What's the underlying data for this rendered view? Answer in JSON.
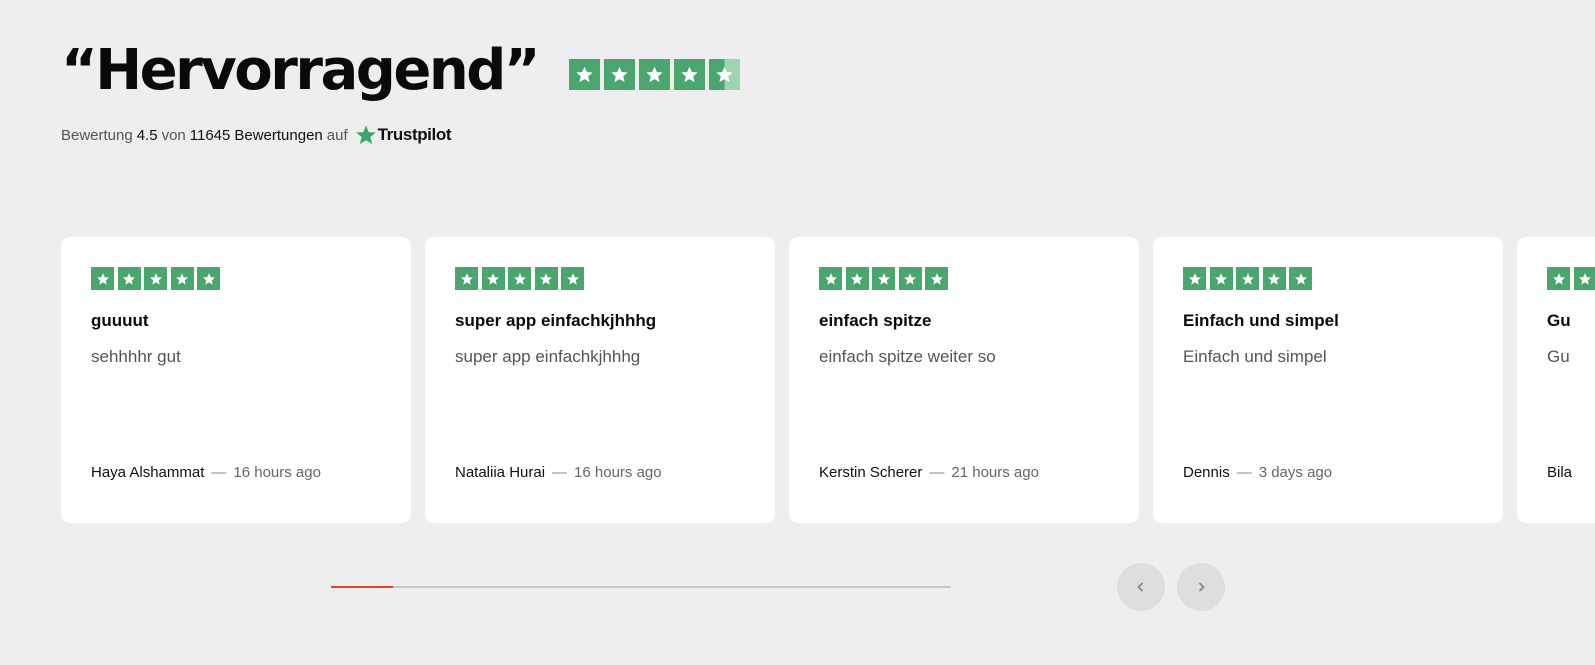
{
  "header": {
    "title": "“Hervorragend”",
    "overall_stars": 4.5,
    "rating_prefix": "Bewertung",
    "rating_value": "4.5",
    "rating_of": "von",
    "review_count": "11645",
    "reviews_word": "Bewertungen",
    "on_word": "auf",
    "platform": "Trustpilot"
  },
  "reviews": [
    {
      "stars": 5,
      "title": "guuuut",
      "text": "sehhhhr gut",
      "author": "Haya Alshammat",
      "time": "16 hours ago"
    },
    {
      "stars": 5,
      "title": "super app einfachkjhhhg",
      "text": "super app einfachkjhhhg",
      "author": "Nataliia Hurai",
      "time": "16 hours ago"
    },
    {
      "stars": 5,
      "title": "einfach spitze",
      "text": "einfach spitze weiter so",
      "author": "Kerstin Scherer",
      "time": "21 hours ago"
    },
    {
      "stars": 5,
      "title": "Einfach und simpel",
      "text": "Einfach und simpel",
      "author": "Dennis",
      "time": "3 days ago"
    },
    {
      "stars": 5,
      "title": "Gu",
      "text": "Gu",
      "author": "Bila",
      "time": ""
    }
  ],
  "carousel": {
    "progress": 0.1,
    "prev_icon": "chevron-left-icon",
    "next_icon": "chevron-right-icon"
  },
  "colors": {
    "star_green": "#4aa56e",
    "accent_red": "#e8412a",
    "background": "#eeeeee"
  }
}
